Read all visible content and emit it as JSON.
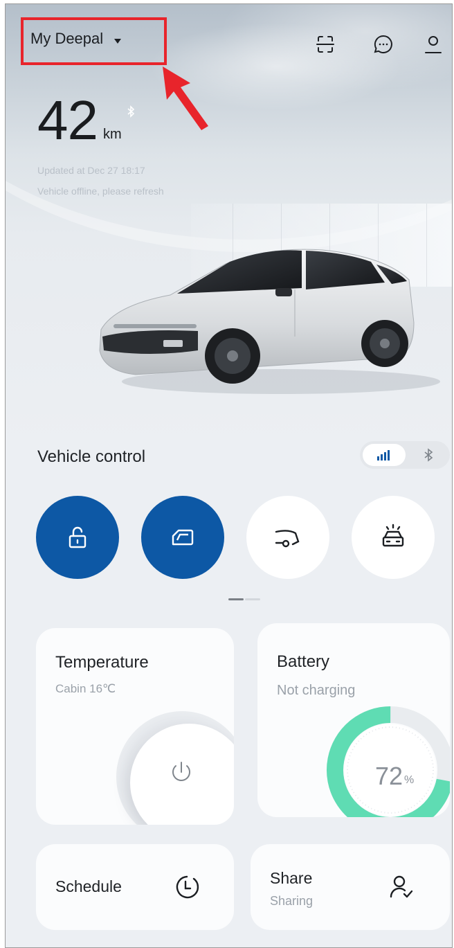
{
  "header": {
    "vehicle_selector": "My Deepal",
    "icons": [
      "scan-icon",
      "message-icon",
      "profile-icon"
    ]
  },
  "status": {
    "range_value": "42",
    "range_unit": "km",
    "updated": "Updated at Dec 27 18:17",
    "connection": "Vehicle offline, please refresh"
  },
  "vehicle_control": {
    "title": "Vehicle control",
    "connection_modes": [
      "cellular-signal-icon",
      "bluetooth-icon"
    ],
    "buttons": [
      {
        "icon": "unlock-icon",
        "state": "active"
      },
      {
        "icon": "window-icon",
        "state": "active"
      },
      {
        "icon": "trunk-icon",
        "state": "idle"
      },
      {
        "icon": "find-car-icon",
        "state": "idle"
      }
    ]
  },
  "cards": {
    "temperature": {
      "title": "Temperature",
      "subtitle": "Cabin 16℃"
    },
    "battery": {
      "title": "Battery",
      "subtitle": "Not charging",
      "level_percent": 72,
      "level_value": "72",
      "level_unit": "%"
    },
    "schedule": {
      "title": "Schedule"
    },
    "share": {
      "title": "Share",
      "subtitle": "Sharing"
    }
  },
  "colors": {
    "accent_blue": "#0d58a5",
    "battery_green": "#5fdcb3",
    "annotation_red": "#e8242b"
  }
}
